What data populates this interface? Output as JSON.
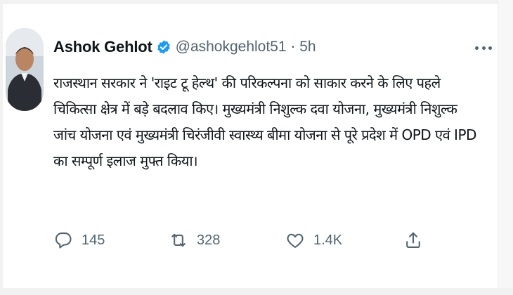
{
  "tweet": {
    "author_name": "Ashok Gehlot",
    "handle": "@ashokgehlot51",
    "separator": "·",
    "time": "5h",
    "verified_color": "#1d9bf0",
    "text_lines": [
      "राजस्थान सरकार ने 'राइट टू हेल्थ' की परिकल्पना को साकार करने के लिए पहले",
      "चिकित्सा क्षेत्र में बड़े बदलाव किए। मुख्यमंत्री निशुल्क दवा योजना, मुख्यमंत्री निशुल्क",
      "जांच योजना एवं मुख्यमंत्री चिरंजीवी स्वास्थ्य बीमा योजना से पूरे प्रदेश में OPD एवं IPD",
      "का सम्पूर्ण इलाज मुफ्त किया।"
    ],
    "actions": {
      "reply_count": "145",
      "retweet_count": "328",
      "like_count": "1.4K"
    },
    "icons": {
      "reply": "reply-icon",
      "retweet": "retweet-icon",
      "like": "heart-icon",
      "share": "share-icon",
      "more": "more-options-icon",
      "verified": "verified-badge-icon"
    }
  }
}
